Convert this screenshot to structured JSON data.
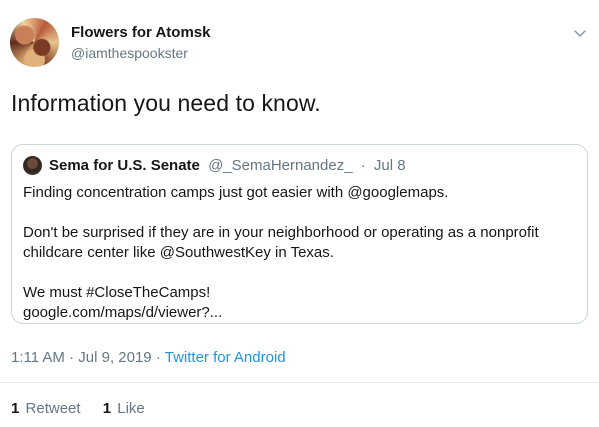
{
  "author": {
    "display_name": "Flowers for Atomsk",
    "handle": "@iamthespookster"
  },
  "tweet": {
    "text": "Information you need to know."
  },
  "quoted_tweet": {
    "name": "Sema for U.S. Senate",
    "handle": "@_SemaHernandez_",
    "separator": "·",
    "date": "Jul 8",
    "lines": [
      "Finding concentration camps just got easier with @googlemaps.",
      "Don't be surprised if they are in your neighborhood or operating as a nonprofit childcare center like @SouthwestKey in Texas.",
      "We must #CloseTheCamps!",
      "google.com/maps/d/viewer?..."
    ]
  },
  "meta": {
    "time": "1:11 AM",
    "separator": "·",
    "date": "Jul 9, 2019",
    "source": "Twitter for Android"
  },
  "stats": {
    "retweets_count": "1",
    "retweets_label": "Retweet",
    "likes_count": "1",
    "likes_label": "Like"
  },
  "colors": {
    "text": "#14171a",
    "muted": "#657786",
    "link": "#1b95e0",
    "border": "#ccd6dd"
  },
  "icons": {
    "menu": "chevron-down-icon"
  }
}
